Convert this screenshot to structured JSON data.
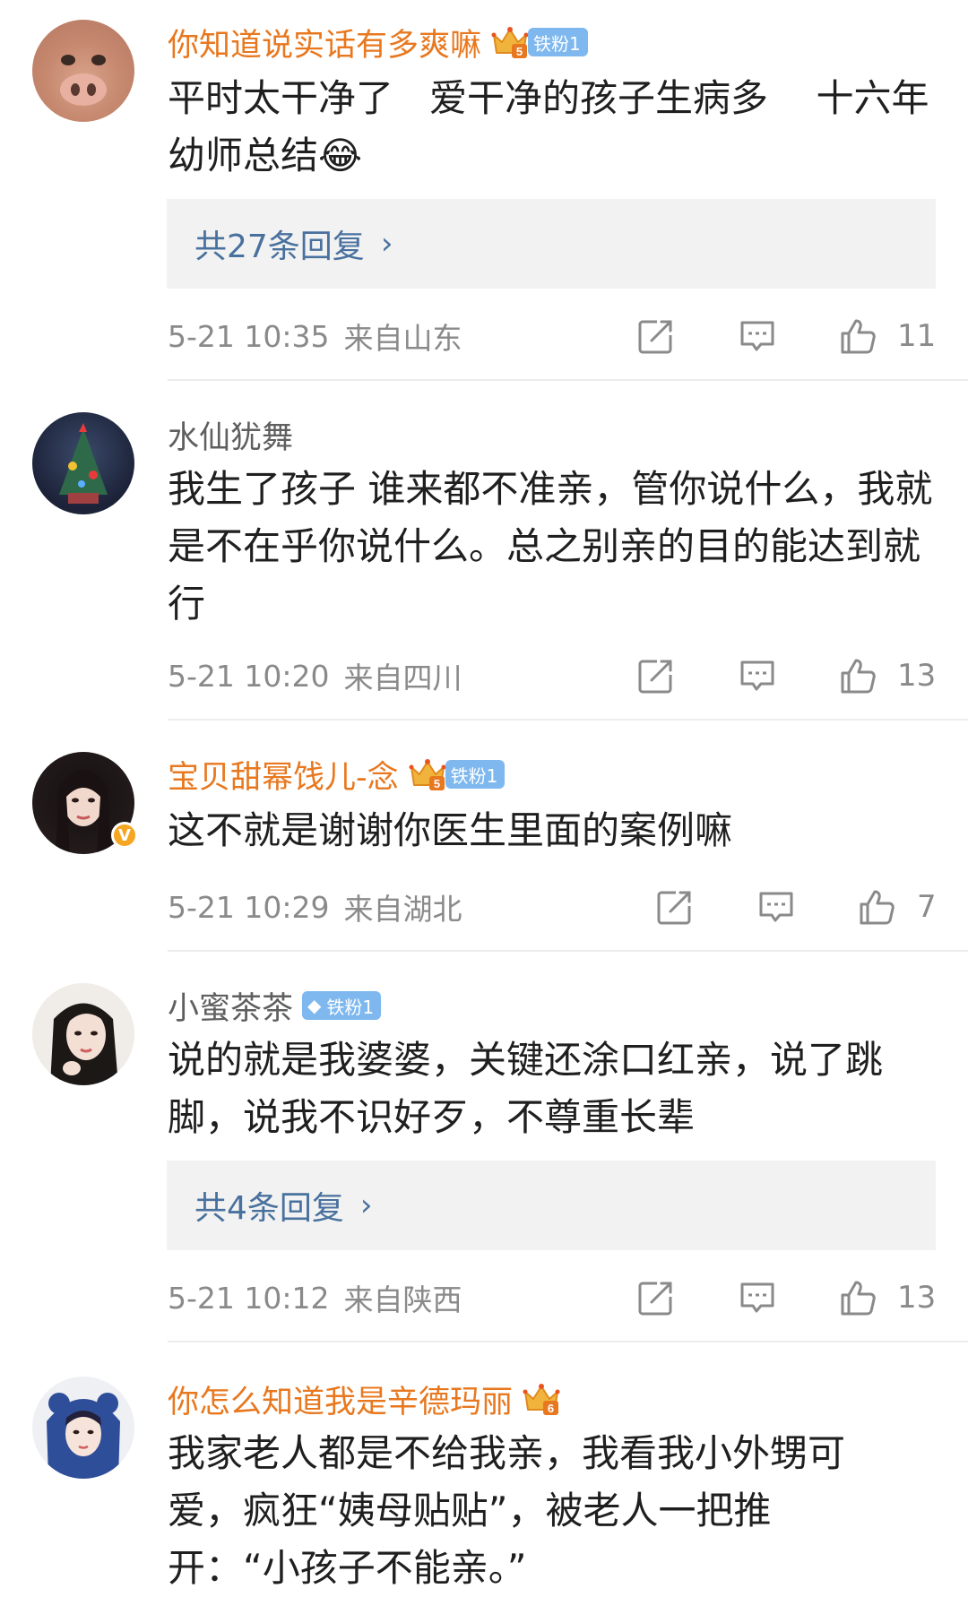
{
  "comments": [
    {
      "username": "你知道说实话有多爽嘛",
      "fan_level": "5",
      "fan_badge": "铁粉1",
      "text": "平时太干净了   爱干净的孩子生病多    十六年幼师总结😂",
      "replies_label": "共27条回复",
      "date": "5-21 10:35",
      "location": "来自山东",
      "likes": "11"
    },
    {
      "username": "水仙犹舞",
      "text": "我生了孩子 谁来都不准亲，管你说什么，我就是不在乎你说什么。总之别亲的目的能达到就行",
      "date": "5-21 10:20",
      "location": "来自四川",
      "likes": "13"
    },
    {
      "username": "宝贝甜幂饯儿-念",
      "fan_level": "5",
      "fan_badge": "铁粉1",
      "verified_badge": "V",
      "text": "这不就是谢谢你医生里面的案例嘛",
      "date": "5-21 10:29",
      "location": "来自湖北",
      "likes": "7"
    },
    {
      "username": "小蜜茶茶",
      "fan_badge": "铁粉1",
      "text": "说的就是我婆婆，关键还涂口红亲，说了跳脚，说我不识好歹，不尊重长辈",
      "replies_label": "共4条回复",
      "date": "5-21 10:12",
      "location": "来自陕西",
      "likes": "13"
    },
    {
      "username": "你怎么知道我是辛德玛丽",
      "fan_level": "6",
      "text": "我家老人都是不给我亲，我看我小外甥可爱，疯狂“姨母贴贴”，被老人一把推开：“小孩子不能亲。”"
    }
  ],
  "icons": {
    "repost": "repost-icon",
    "comment": "comment-icon",
    "like": "thumbs-up-icon",
    "chevron": "chevron-right-icon",
    "crown": "crown-icon",
    "diamond": "diamond-icon"
  },
  "colors": {
    "vip_name": "#e8781f",
    "normal_name": "#5f5f5f",
    "link": "#49719e",
    "meta": "#8a8a8a",
    "fan_badge": "#7eb8ef",
    "reply_box": "#f2f2f2"
  }
}
